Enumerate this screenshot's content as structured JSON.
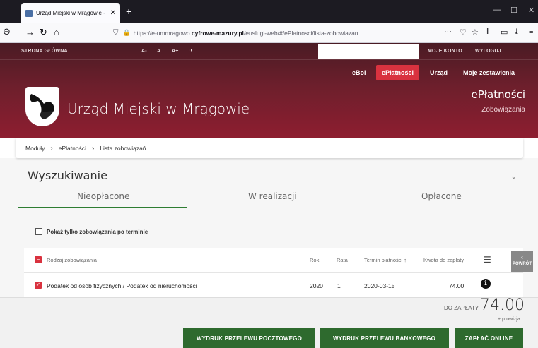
{
  "browser": {
    "tab_title": "Urząd Miejski w Mrągowie - Li",
    "tab_close": "✕",
    "new_tab": "+",
    "url_prefix": "https://e-ummragowo.",
    "url_domain": "cyfrowe-mazury.pl",
    "url_suffix": "/euslugi-web/#/ePlatnosci/lista-zobowiazan",
    "url_more": "···"
  },
  "topnav": {
    "home": "STRONA GŁÓWNA",
    "font_small": "A-",
    "font_normal": "A",
    "font_large": "A+",
    "contrast": "◑",
    "account": "MOJE KONTO",
    "logout": "WYLOGUJ"
  },
  "menu": {
    "eboi": "eBoi",
    "eplatnosci": "ePłatności",
    "urzad": "Urząd",
    "zestawienia": "Moje zestawienia"
  },
  "site": {
    "title": "Urząd Miejski w Mrągowie",
    "module_title": "ePłatności",
    "module_subtitle": "Zobowiązania"
  },
  "breadcrumb": [
    "Moduły",
    "ePłatności",
    "Lista zobowiązań"
  ],
  "search": {
    "title": "Wyszukiwanie",
    "tabs": [
      "Nieopłacone",
      "W realizacji",
      "Opłacone"
    ],
    "overdue_only_label": "Pokaż tylko zobowiązania po terminie"
  },
  "table": {
    "headers": {
      "type": "Rodzaj zobowiązania",
      "year": "Rok",
      "installment": "Rata",
      "due_date": "Termin płatności",
      "amount": "Kwota do zapłaty"
    },
    "rows": [
      {
        "type": "Podatek od osób fizycznych / Podatek od nieruchomości",
        "year": "2020",
        "installment": "1",
        "due_date": "2020-03-15",
        "amount": "74.00"
      }
    ]
  },
  "back_button": "POWRÓT",
  "summary": {
    "label": "DO ZAPŁATY",
    "amount": "74.00",
    "fee": "+ prowizja"
  },
  "actions": {
    "postal": "WYDRUK PRZELEWU POCZTOWEGO",
    "bank": "WYDRUK PRZELEWU BANKOWEGO",
    "online": "ZAPŁAĆ ONLINE"
  },
  "colors": {
    "header": "#6d1f2c",
    "accent_red": "#d9323f",
    "green": "#2e6a2e"
  }
}
